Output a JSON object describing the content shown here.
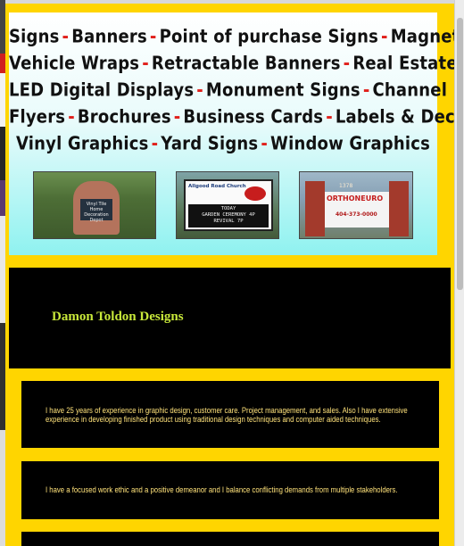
{
  "banner": {
    "lines": [
      [
        "Signs",
        "Banners",
        "Point of purchase Signs",
        "Magnetics"
      ],
      [
        "Vehicle Wraps",
        "Retractable Banners",
        "Real Estate Signs"
      ],
      [
        "LED Digital Displays",
        "Monument Signs",
        "Channel Letters"
      ],
      [
        "Flyers",
        "Brochures",
        "Business Cards",
        "Labels & Decals"
      ],
      [
        "Vinyl Graphics",
        "Yard Signs",
        "Window Graphics"
      ]
    ],
    "separator": "-",
    "photos": [
      {
        "name": "monument-sign-photo",
        "sign_text": "Vinyl Tile Home Decoration Depot"
      },
      {
        "name": "led-church-sign-photo",
        "header": "Allgood Road Church",
        "led_lines": [
          "TODAY",
          "GARDEN CEREMONY 4P",
          "REVIVAL 7P"
        ]
      },
      {
        "name": "orthoneuro-sign-photo",
        "number": "1378",
        "brand": "ORTHONEURO",
        "phone": "404-373-0000"
      }
    ]
  },
  "site": {
    "title": "Damon Toldon Designs"
  },
  "about": {
    "paragraphs": [
      "I have 25 years of experience in graphic design, customer care. Project management, and sales. Also I have extensive experience in developing finished product using traditional design techniques and computer aided techniques.",
      "I have a focused work ethic and a positive demeanor and I balance conflicting demands from multiple stakeholders.",
      ""
    ]
  },
  "colors": {
    "page_background": "#ffd500",
    "title_color": "#c8e83a",
    "paragraph_color": "#ffe27a",
    "separator_color": "#e0201b"
  }
}
